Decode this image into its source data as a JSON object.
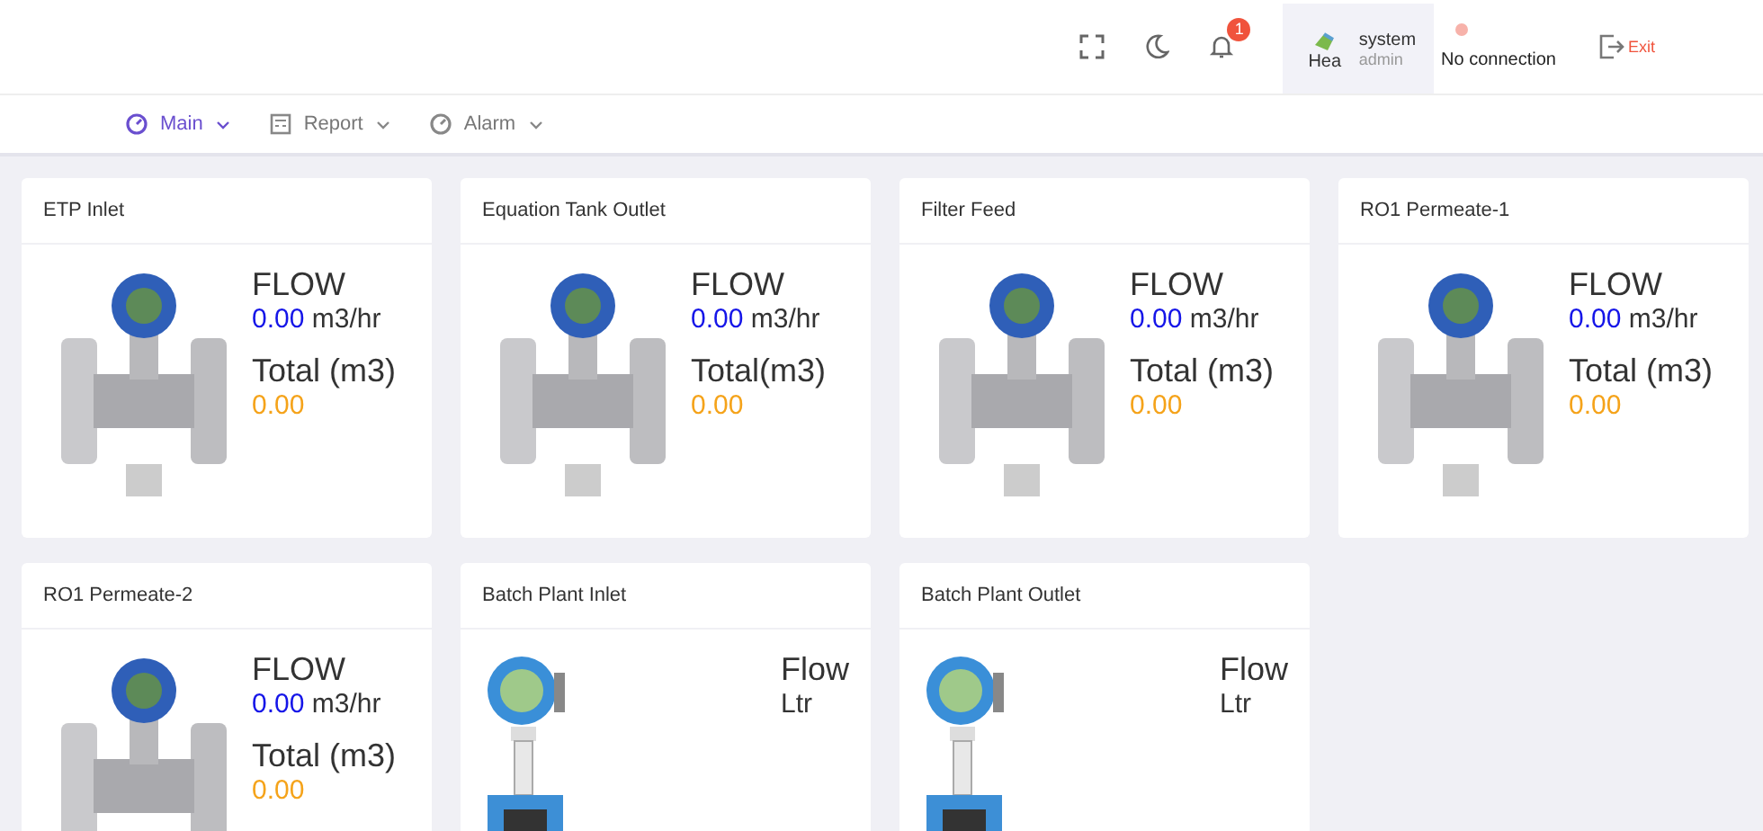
{
  "topbar": {
    "notification_count": "1",
    "user": {
      "avatar_alt": "Hea",
      "name": "system",
      "role": "admin"
    },
    "connection": {
      "connected": false,
      "label": "No connection"
    },
    "exit_label": "Exit"
  },
  "nav": [
    {
      "label": "Main",
      "kind": "gauge",
      "selected": true
    },
    {
      "label": "Report",
      "kind": "report",
      "selected": false
    },
    {
      "label": "Alarm",
      "kind": "gauge",
      "selected": false
    }
  ],
  "cards": [
    {
      "kind": "turbine",
      "title": "ETP Inlet",
      "flow_label": "FLOW",
      "flow_value": "0.00",
      "flow_unit": "m3/hr",
      "total_label": "Total (m3)",
      "total_value": "0.00"
    },
    {
      "kind": "turbine",
      "title": "Equation Tank Outlet",
      "flow_label": "FLOW",
      "flow_value": "0.00",
      "flow_unit": "m3/hr",
      "total_label": "Total(m3)",
      "total_value": "0.00"
    },
    {
      "kind": "turbine",
      "title": "Filter Feed",
      "flow_label": "FLOW",
      "flow_value": "0.00",
      "flow_unit": "m3/hr",
      "total_label": "Total (m3)",
      "total_value": "0.00"
    },
    {
      "kind": "turbine",
      "title": "RO1 Permeate-1",
      "flow_label": "FLOW",
      "flow_value": "0.00",
      "flow_unit": "m3/hr",
      "total_label": "Total (m3)",
      "total_value": "0.00"
    },
    {
      "kind": "turbine",
      "title": "RO1 Permeate-2",
      "flow_label": "FLOW",
      "flow_value": "0.00",
      "flow_unit": "m3/hr",
      "total_label": "Total (m3)",
      "total_value": "0.00"
    },
    {
      "kind": "magnetic",
      "title": "Batch Plant Inlet",
      "flow_label": "Flow",
      "flow_unit": "Ltr"
    },
    {
      "kind": "magnetic",
      "title": "Batch Plant Outlet",
      "flow_label": "Flow",
      "flow_unit": "Ltr"
    }
  ]
}
